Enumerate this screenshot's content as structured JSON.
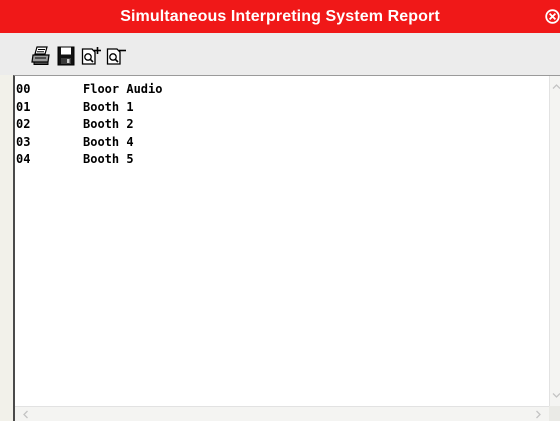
{
  "window": {
    "title": "Simultaneous Interpreting System Report"
  },
  "toolbar": {
    "buttons": [
      {
        "icon": "printer-icon"
      },
      {
        "icon": "save-disk-icon"
      },
      {
        "icon": "zoom-in-icon"
      },
      {
        "icon": "zoom-out-icon"
      }
    ]
  },
  "report": {
    "lines": [
      {
        "code": "00",
        "name": "Floor Audio"
      },
      {
        "code": "01",
        "name": "Booth 1"
      },
      {
        "code": "02",
        "name": "Booth 2"
      },
      {
        "code": "03",
        "name": "Booth 4"
      },
      {
        "code": "04",
        "name": "Booth 5"
      }
    ]
  },
  "colors": {
    "titlebar": "#f01818",
    "title_text": "#ffffff",
    "toolbar": "#ececec",
    "panel": "#ffffff"
  }
}
